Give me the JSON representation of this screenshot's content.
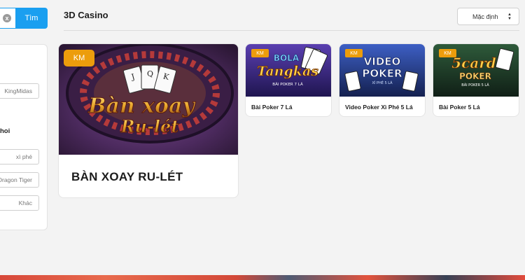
{
  "search": {
    "button_label": "Tìm",
    "clear_icon": "x"
  },
  "filters": {
    "chips_top": [
      "KingMidas"
    ],
    "section_label": "hoi",
    "chips_bottom": [
      "xì phé",
      "Dragon Tiger",
      "Khác"
    ]
  },
  "header": {
    "title": "3D Casino",
    "sort_label": "Mặc định"
  },
  "games": {
    "featured": {
      "badge": "KM",
      "title": "BÀN XOAY RU-LÉT",
      "art_line1": "Bàn xoay",
      "art_line2": "Ru-lét"
    },
    "items": [
      {
        "badge": "KM",
        "title": "Bài Poker 7 Lá",
        "art_line1": "BOLA",
        "art_line2": "Tangkas",
        "art_line3": "BÀI POKER 7 LÁ"
      },
      {
        "badge": "KM",
        "title": "Video Poker Xì Phé 5 Lá",
        "art_line1": "VIDEO",
        "art_line2": "POKER",
        "art_line3": "XÌ PHÉ 5 LÁ"
      },
      {
        "badge": "KM",
        "title": "Bài Poker 5 Lá",
        "art_line1": "5card",
        "art_line2": "POKER",
        "art_line3": "BÀI POKER 5 LÁ"
      }
    ]
  },
  "colors": {
    "accent": "#1a9ff0",
    "badge": "#ec9d0c"
  }
}
